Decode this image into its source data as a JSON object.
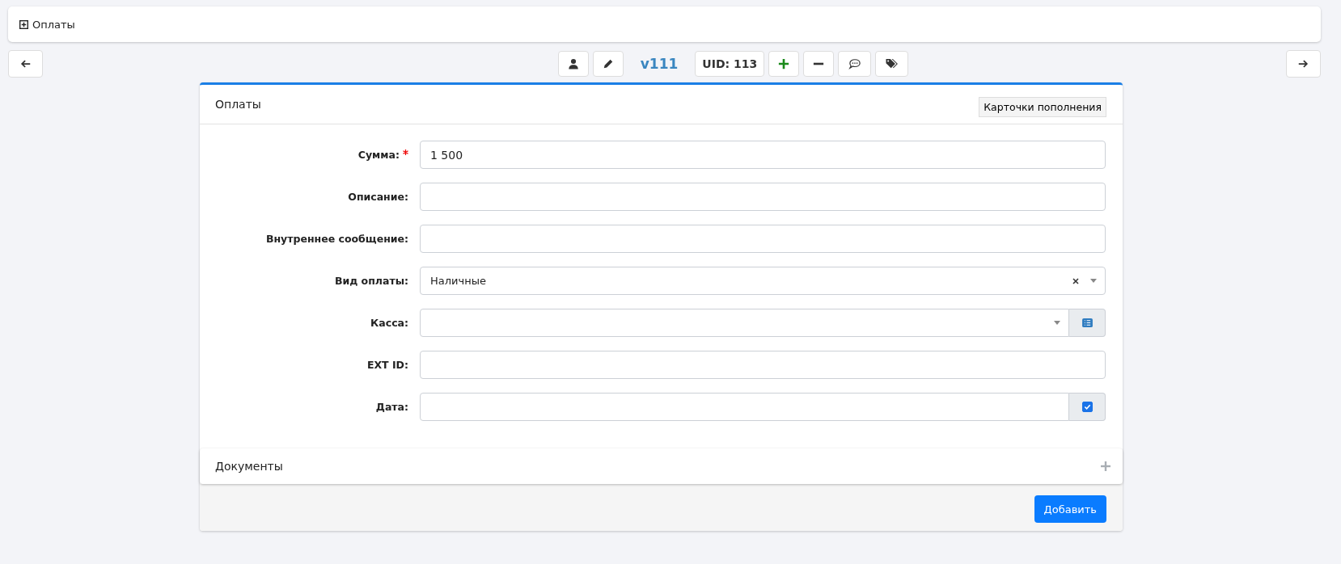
{
  "top_panel": {
    "title": "Оплаты",
    "expanded": false
  },
  "toolbar": {
    "version": "v111",
    "uid": "UID: 113"
  },
  "card": {
    "title": "Оплаты",
    "header_button": "Карточки пополнения",
    "fields": [
      {
        "kind": "text",
        "label": "Сумма:",
        "required": true,
        "value": "1 500"
      },
      {
        "kind": "text",
        "label": "Описание:",
        "required": false
      },
      {
        "kind": "text",
        "label": "Внутреннее сообщение:",
        "required": false
      },
      {
        "kind": "select",
        "label": "Вид оплаты:",
        "required": false,
        "value": "Наличные",
        "clearable": true
      },
      {
        "kind": "select-list",
        "label": "Касса:",
        "required": false
      },
      {
        "kind": "text",
        "label": "EXT ID:",
        "required": false
      },
      {
        "kind": "date",
        "label": "Дата:",
        "required": false,
        "checked": true
      }
    ],
    "documents": {
      "title": "Документы",
      "expanded": false
    },
    "submit": "Добавить"
  }
}
